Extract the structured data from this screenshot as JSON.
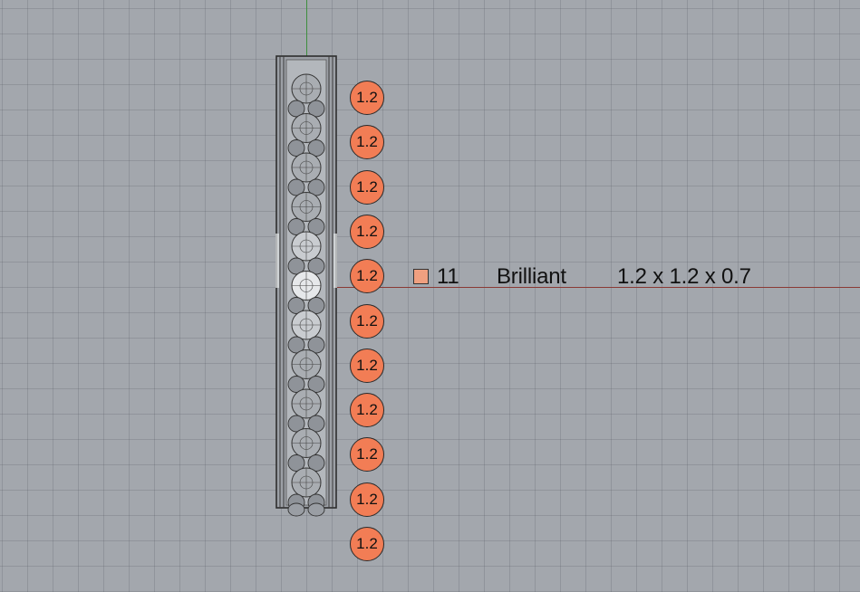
{
  "viewport": {
    "background": "#a3a7ad",
    "axis_x_color": "#8a3a34",
    "axis_y_color": "#3f8f3f"
  },
  "stone_badges": {
    "color": "#f27d55",
    "labels": [
      "1.2",
      "1.2",
      "1.2",
      "1.2",
      "1.2",
      "1.2",
      "1.2",
      "1.2",
      "1.2",
      "1.2",
      "1.2"
    ]
  },
  "stone_summary": {
    "swatch_color": "#f0a080",
    "count": "11",
    "cut": "Brilliant",
    "dimensions": "1.2 x 1.2 x 0.7"
  }
}
